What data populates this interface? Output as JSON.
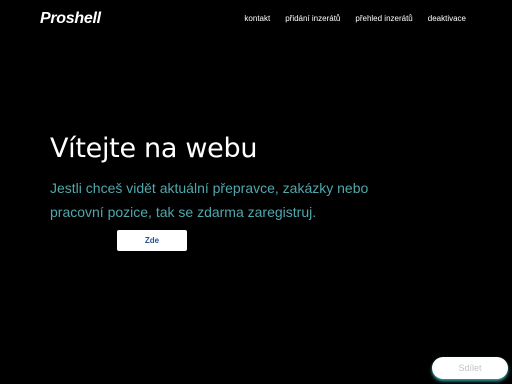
{
  "header": {
    "logo": "Proshell",
    "nav": [
      {
        "label": "kontakt"
      },
      {
        "label": "přidání inzerátů"
      },
      {
        "label": "přehled inzerátů"
      },
      {
        "label": "deaktivace"
      }
    ]
  },
  "hero": {
    "title": "Vítejte na webu",
    "text": "Jestli chceš vidět aktuální přepravce, zakázky nebo pracovní pozice, tak se zdarma zaregistruj.",
    "button_label": "Zde"
  },
  "share": {
    "label": "Sdílet"
  },
  "colors": {
    "background": "#000000",
    "accent_text": "#4fa8ad",
    "button_text": "#2a4f8f"
  }
}
